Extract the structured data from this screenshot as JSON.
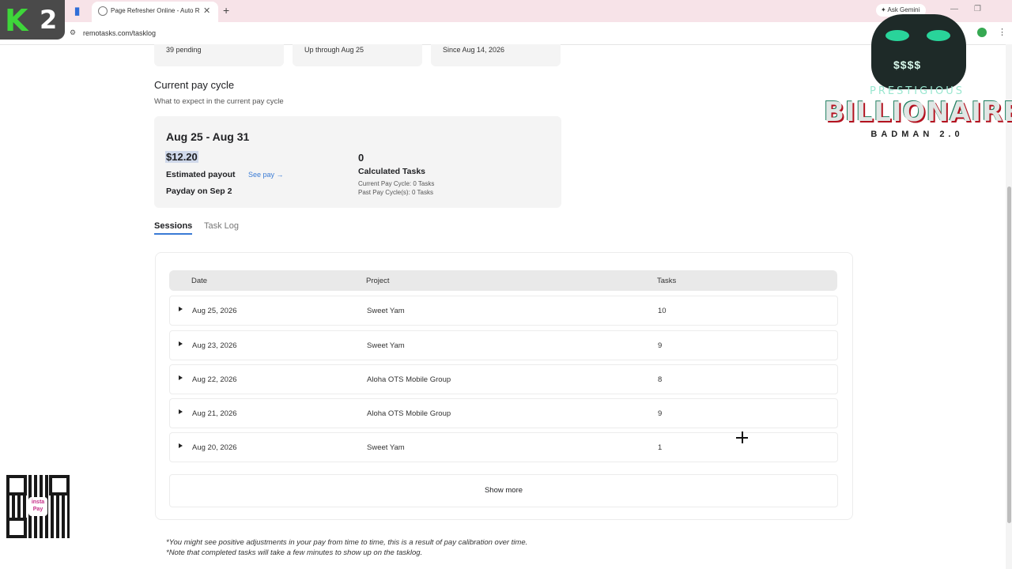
{
  "browser": {
    "active_tab_title": "Page Refresher Online - Auto R",
    "new_tab_symbol": "+",
    "close_symbol": "✕",
    "gemini_label": "Ask Gemini",
    "url": "remotasks.com/tasklog"
  },
  "overlays": {
    "k2_letter": "K",
    "k2_number": "2",
    "logo_dollars": "$$$$",
    "logo_line1": "PRESTIGIOUS",
    "logo_line2": "BILLIONAIRE",
    "logo_line3": "BADMAN 2.0",
    "qr_label_1": "insta",
    "qr_label_2": "Pay"
  },
  "stats": [
    {
      "text": "39 pending"
    },
    {
      "text": "Up through Aug 25"
    },
    {
      "text": "Since Aug 14, 2026"
    }
  ],
  "pay_cycle": {
    "heading": "Current pay cycle",
    "subheading": "What to expect in the current pay cycle",
    "range": "Aug 25 - Aug 31",
    "amount": "$12.20",
    "estimated_label": "Estimated payout",
    "see_pay_label": "See pay →",
    "payday": "Payday on Sep 2",
    "task_count": "0",
    "calculated_label": "Calculated Tasks",
    "current_cycle": "Current Pay Cycle: 0 Tasks",
    "past_cycles": "Past Pay Cycle(s): 0 Tasks"
  },
  "tabs": {
    "sessions": "Sessions",
    "task_log": "Task Log"
  },
  "table": {
    "headers": {
      "date": "Date",
      "project": "Project",
      "tasks": "Tasks"
    },
    "rows": [
      {
        "date": "Aug 25, 2026",
        "project": "Sweet Yam",
        "tasks": "10"
      },
      {
        "date": "Aug 23, 2026",
        "project": "Sweet Yam",
        "tasks": "9"
      },
      {
        "date": "Aug 22, 2026",
        "project": "Aloha OTS Mobile Group",
        "tasks": "8"
      },
      {
        "date": "Aug 21, 2026",
        "project": "Aloha OTS Mobile Group",
        "tasks": "9"
      },
      {
        "date": "Aug 20, 2026",
        "project": "Sweet Yam",
        "tasks": "1"
      }
    ],
    "show_more": "Show more"
  },
  "notes": [
    "*You might see positive adjustments in your pay from time to time, this is a result of pay calibration over time.",
    "*Note that completed tasks will take a few minutes to show up on the tasklog."
  ],
  "colors": {
    "accent": "#3a7bd5",
    "tabbar": "#f7e3e8",
    "card_bg": "#f4f4f4"
  }
}
